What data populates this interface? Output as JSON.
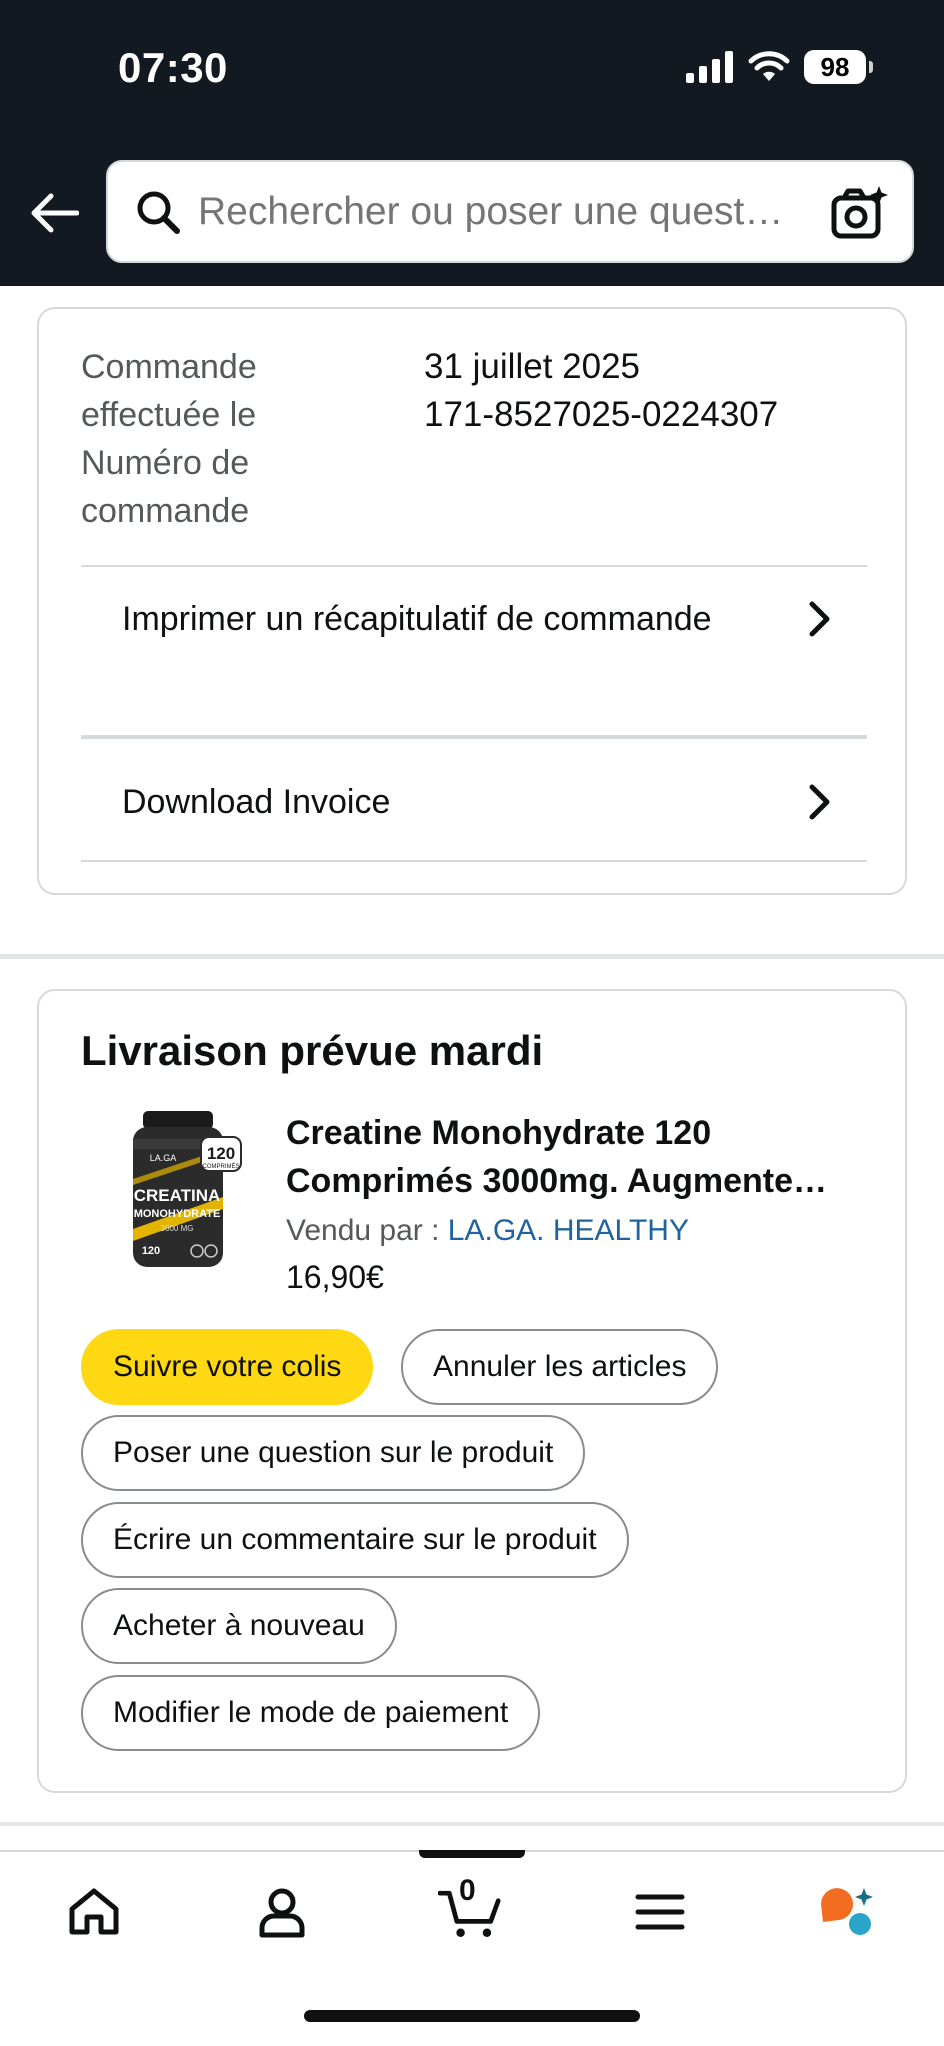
{
  "status_bar": {
    "time": "07:30",
    "battery": "98"
  },
  "search": {
    "placeholder": "Rechercher ou poser une quest…"
  },
  "order_meta": {
    "date_label_line1": "Commande",
    "date_label_line2": "effectuée le",
    "number_label_line1": "Numéro de",
    "number_label_line2": "commande",
    "date_value": "31 juillet 2025",
    "number_value": "171-8527025-0224307"
  },
  "order_actions": {
    "print_summary": "Imprimer un récapitulatif de commande",
    "download_invoice": "Download Invoice"
  },
  "delivery": {
    "title": "Livraison prévue mardi",
    "product_title": "Creatine Monohydrate 120 Comprimés 3000mg. Augmente…",
    "seller_prefix": "Vendu par  : ",
    "seller_name": "LA.GA. HEALTHY",
    "price": "16,90€",
    "product_image_text": {
      "brand": "LA.GA",
      "count": "120",
      "count_sub": "COMPRIMÉS",
      "name1": "CREATINA",
      "name2": "MONOHYDRATE",
      "dose": "3000 MG"
    }
  },
  "buttons": {
    "track": "Suivre votre colis",
    "cancel": "Annuler les articles",
    "ask": "Poser une question sur le produit",
    "review": "Écrire un commentaire sur le produit",
    "buy_again": "Acheter à nouveau",
    "payment": "Modifier le mode de paiement"
  },
  "nav": {
    "cart_count": "0"
  },
  "colors": {
    "header_bg": "#131921",
    "primary_button": "#ffd814",
    "link": "#2162a1",
    "text": "#0f1111",
    "muted": "#565959"
  }
}
